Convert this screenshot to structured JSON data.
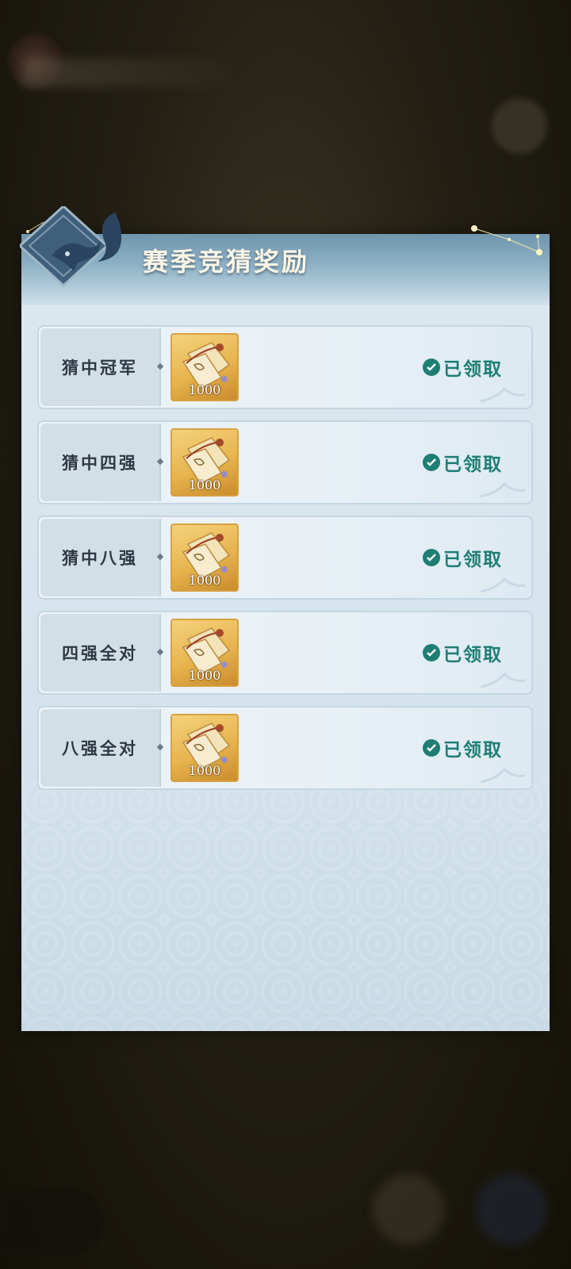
{
  "panel": {
    "title": "赛季竞猜奖励"
  },
  "rewards": [
    {
      "label": "猜中冠军",
      "item_count": "1000",
      "status": "已领取"
    },
    {
      "label": "猜中四强",
      "item_count": "1000",
      "status": "已领取"
    },
    {
      "label": "猜中八强",
      "item_count": "1000",
      "status": "已领取"
    },
    {
      "label": "四强全对",
      "item_count": "1000",
      "status": "已领取"
    },
    {
      "label": "八强全对",
      "item_count": "1000",
      "status": "已领取"
    }
  ],
  "colors": {
    "status_green": "#1e7e74",
    "item_gold": "#e7b44d",
    "header_blue": "#6f95ad"
  },
  "icons": {
    "emblem": "fox-emblem-icon",
    "status": "check-circle-icon",
    "reward": "paper-bundle-icon"
  }
}
